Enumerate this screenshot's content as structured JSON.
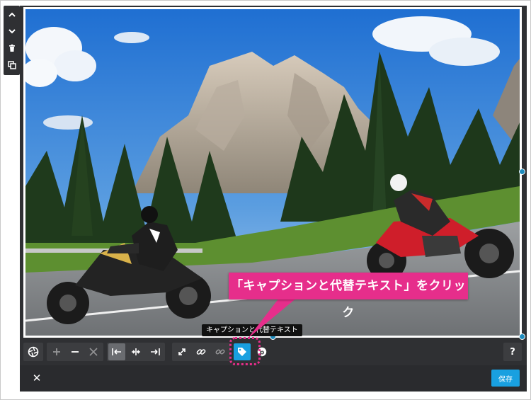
{
  "side_toolbar": {
    "icons": [
      "chevron-up-icon",
      "chevron-down-icon",
      "trash-icon",
      "duplicate-icon"
    ]
  },
  "image": {
    "subject": "",
    "alt": ""
  },
  "toolbar": {
    "icons": [
      "aperture-icon",
      "zoom-in-icon",
      "zoom-out-icon",
      "fit-icon",
      "align-left-icon",
      "align-center-icon",
      "align-right-icon",
      "resize-icon",
      "link-icon",
      "unlink-icon",
      "tag-icon",
      "pinterest-icon",
      "help-icon"
    ],
    "help_label": "?"
  },
  "tooltip": {
    "text": "キャプションと代替テキスト"
  },
  "callout": {
    "text": "「キャプションと代替テキスト」をクリック",
    "color": "#e62e8b"
  },
  "bottom_bar": {
    "close_label": "✕",
    "save_label": "保存"
  },
  "colors": {
    "accent": "#19a0e0",
    "dark": "#2f3033"
  }
}
